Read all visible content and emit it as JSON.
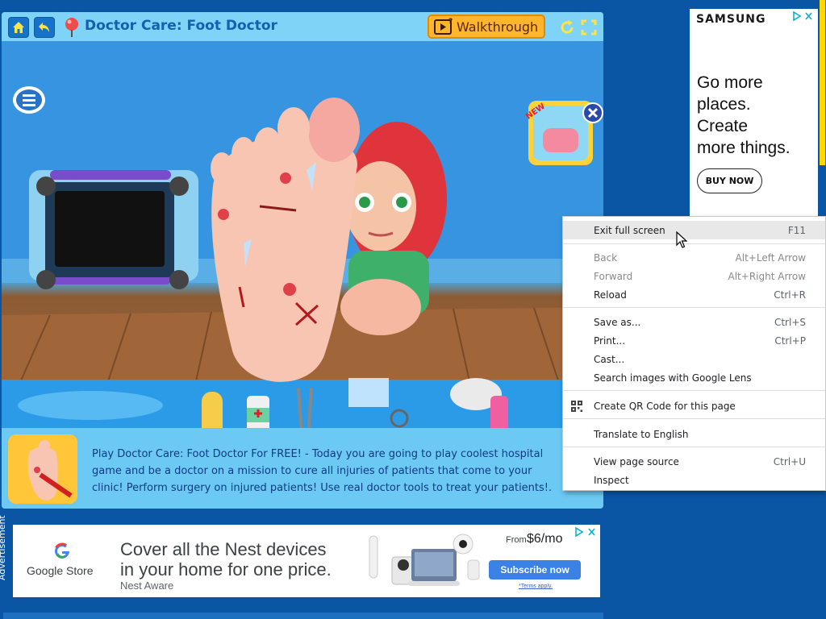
{
  "game": {
    "title": "Doctor Care: Foot Doctor",
    "walkthrough_label": "Walkthrough",
    "new_badge": "NEW",
    "description": "Play Doctor Care: Foot Doctor For FREE! - Today you are going to play coolest hospital game and be a doctor on a mission to cure all injuries of patients that come to your clinic! Perform surgery on injured patients! Use real doctor tools to treat your patients!."
  },
  "right_ad": {
    "brand": "SAMSUNG",
    "headline_lines": [
      "Go more",
      "places.",
      "Create",
      "more things."
    ],
    "cta": "BUY NOW"
  },
  "bottom_ad": {
    "vertical_label": "Advertisement",
    "store": "Google Store",
    "headline_line1": "Cover all the Nest devices",
    "headline_line2": "in your home for one price.",
    "sub": "Nest Aware",
    "price_from": "From",
    "price": "$6/mo",
    "cta": "Subscribe now",
    "terms": "*Terms apply."
  },
  "context_menu": {
    "items": [
      {
        "label": "Exit full screen",
        "shortcut": "F11",
        "disabled": false,
        "hover": true
      },
      {
        "label": "Back",
        "shortcut": "Alt+Left Arrow",
        "disabled": true
      },
      {
        "label": "Forward",
        "shortcut": "Alt+Right Arrow",
        "disabled": true
      },
      {
        "label": "Reload",
        "shortcut": "Ctrl+R",
        "disabled": false
      },
      {
        "label": "Save as...",
        "shortcut": "Ctrl+S",
        "disabled": false
      },
      {
        "label": "Print...",
        "shortcut": "Ctrl+P",
        "disabled": false
      },
      {
        "label": "Cast...",
        "shortcut": "",
        "disabled": false
      },
      {
        "label": "Search images with Google Lens",
        "shortcut": "",
        "disabled": false
      },
      {
        "label": "Create QR Code for this page",
        "shortcut": "",
        "disabled": false
      },
      {
        "label": "Translate to English",
        "shortcut": "",
        "disabled": false
      },
      {
        "label": "View page source",
        "shortcut": "Ctrl+U",
        "disabled": false
      },
      {
        "label": "Inspect",
        "shortcut": "",
        "disabled": false
      }
    ]
  },
  "colors": {
    "page_bg": "#0a56a4",
    "panel_bg": "#6cc9f4",
    "title_text": "#1460b0",
    "walkthrough_bg": "#ffb52c",
    "subscribe_bg": "#3b82e6"
  },
  "icons": [
    "home-icon",
    "back-arrow-icon",
    "pin-icon",
    "play-icon",
    "refresh-icon",
    "fullscreen-icon",
    "menu-list-icon",
    "close-icon",
    "google-g-icon",
    "adchoices-icon",
    "qr-code-icon",
    "cursor-icon"
  ]
}
